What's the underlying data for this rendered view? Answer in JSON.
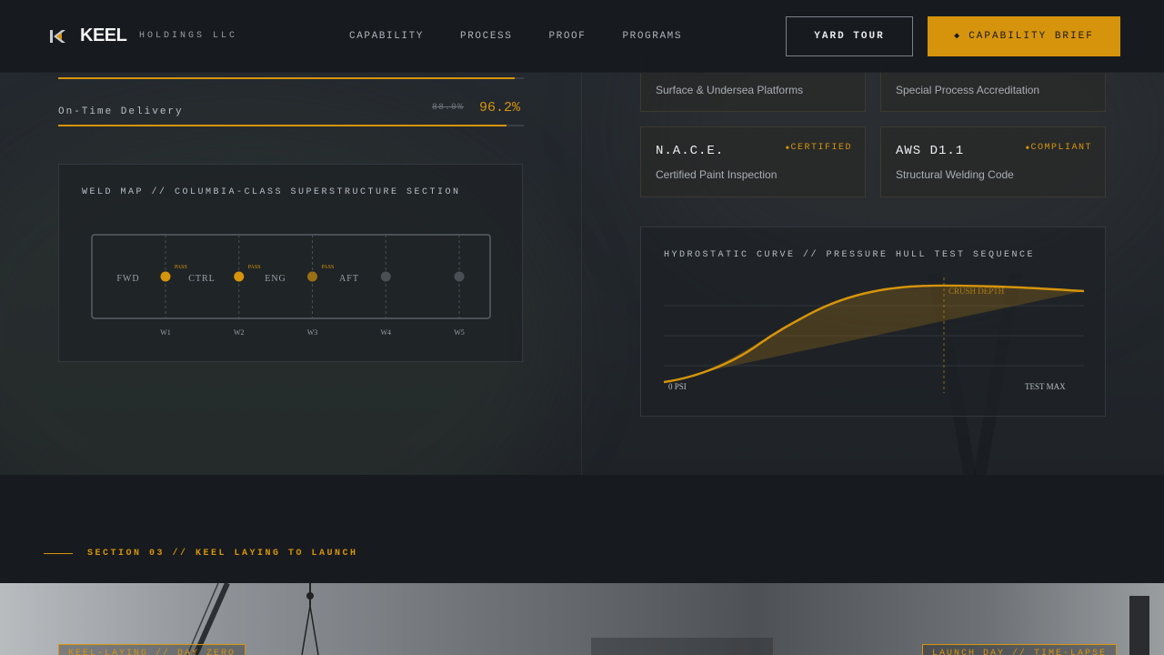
{
  "header": {
    "brand": "KEEL",
    "brand_sub": "HOLDINGS LLC",
    "nav": [
      "CAPABILITY",
      "PROCESS",
      "PROOF",
      "PROGRAMS"
    ],
    "btn_tour": "YARD TOUR",
    "btn_brief": "CAPABILITY BRIEF",
    "btn_brief_icon": "◆"
  },
  "metrics": {
    "top_bar_fill": 0.98,
    "ontime_label": "On-Time Delivery",
    "ontime_old": "88.0%",
    "ontime_new": "96.2%",
    "ontime_fill": 0.962
  },
  "weld_map": {
    "title": "WELD MAP // COLUMBIA-CLASS SUPERSTRUCTURE SECTION",
    "sections": [
      "FWD",
      "CTRL",
      "ENG",
      "AFT"
    ],
    "welds": [
      {
        "label": "W1",
        "status": "PASS"
      },
      {
        "label": "W2",
        "status": "PASS"
      },
      {
        "label": "W3",
        "status": "PASS"
      },
      {
        "label": "W4",
        "status": ""
      },
      {
        "label": "W5",
        "status": ""
      }
    ]
  },
  "certs": [
    {
      "code": "",
      "desc": "Surface & Undersea Platforms",
      "badge": ""
    },
    {
      "code": "",
      "desc": "Special Process Accreditation",
      "badge": ""
    },
    {
      "code": "N.A.C.E.",
      "desc": "Certified Paint Inspection",
      "badge": "CERTIFIED"
    },
    {
      "code": "AWS D1.1",
      "desc": "Structural Welding Code",
      "badge": "COMPLIANT"
    }
  ],
  "hydro": {
    "title": "HYDROSTATIC CURVE // PRESSURE HULL TEST SEQUENCE",
    "marker_label": "CRUSH DEPTH",
    "x_start_label": "0 PSI",
    "x_end_label": "TEST MAX"
  },
  "section": {
    "label": "SECTION 03 // KEEL LAYING TO LAUNCH"
  },
  "photo": {
    "tag_left": "KEEL-LAYING // DAY ZERO",
    "tag_right": "LAUNCH DAY // TIME-LAPSE"
  },
  "colors": {
    "accent": "#d6940c",
    "background": "#171a1e",
    "panel": "#1e2226"
  }
}
